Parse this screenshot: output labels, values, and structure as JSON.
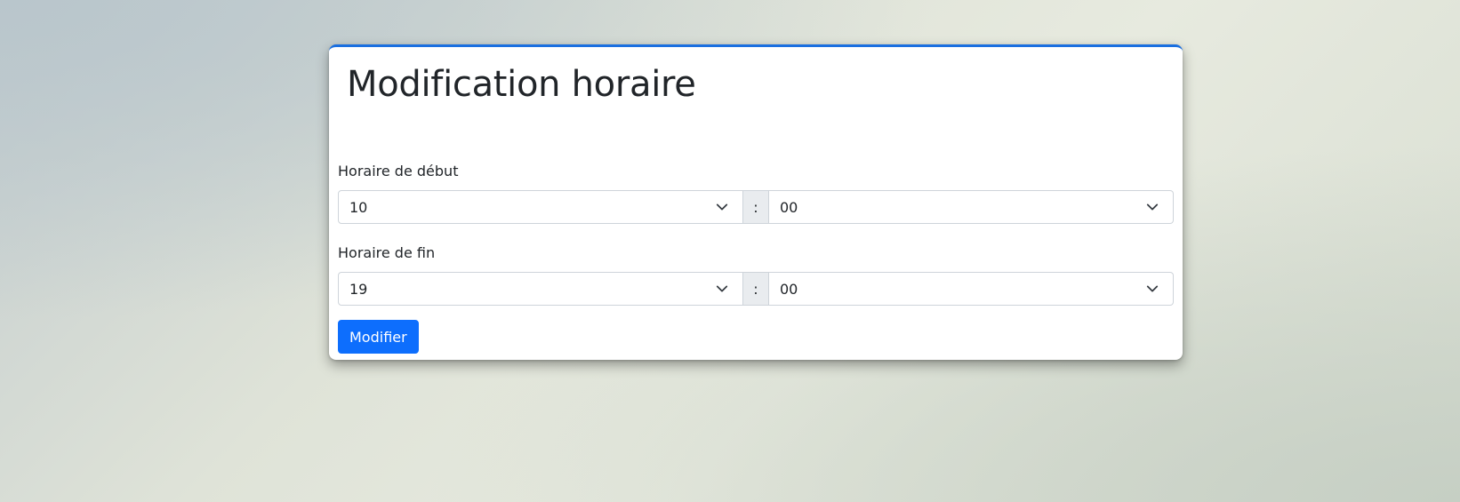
{
  "page": {
    "title": "Modification horaire"
  },
  "form": {
    "start": {
      "label": "Horaire de début",
      "hour": "10",
      "separator": ":",
      "minute": "00"
    },
    "end": {
      "label": "Horaire de fin",
      "hour": "19",
      "separator": ":",
      "minute": "00"
    },
    "submit_label": "Modifier"
  },
  "colors": {
    "accent": "#0d6efd",
    "card_border_top": "#1a6fe0"
  },
  "icons": {
    "select_indicator": "chevron-down-icon"
  }
}
